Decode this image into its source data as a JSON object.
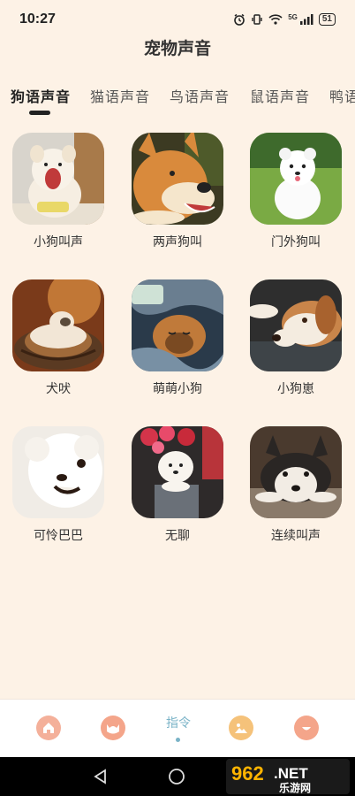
{
  "status_bar": {
    "time": "10:27",
    "battery": "51",
    "network": "5G"
  },
  "page_title": "宠物声音",
  "tabs": [
    {
      "label": "狗语声音",
      "active": true
    },
    {
      "label": "猫语声音",
      "active": false
    },
    {
      "label": "鸟语声音",
      "active": false
    },
    {
      "label": "鼠语声音",
      "active": false
    },
    {
      "label": "鸭语",
      "active": false
    }
  ],
  "sounds": [
    {
      "label": "小狗叫声",
      "image": "fluffy-puppy-yawning"
    },
    {
      "label": "两声狗叫",
      "image": "shiba-barking"
    },
    {
      "label": "门外狗叫",
      "image": "white-pomeranian-on-grass"
    },
    {
      "label": "犬吠",
      "image": "puppy-sleeping-in-basket"
    },
    {
      "label": "萌萌小狗",
      "image": "brown-puppy-under-blanket"
    },
    {
      "label": "小狗崽",
      "image": "beagle-lying-on-sofa"
    },
    {
      "label": "可怜巴巴",
      "image": "smiling-white-pomeranian"
    },
    {
      "label": "无聊",
      "image": "maltese-with-flowers"
    },
    {
      "label": "连续叫声",
      "image": "husky-lying-down"
    }
  ],
  "bottom_nav": {
    "items": [
      {
        "name": "home",
        "icon": "home-icon",
        "color": "#f4a58a"
      },
      {
        "name": "cat",
        "icon": "cat-face-icon",
        "color": "#f4a58a"
      },
      {
        "name": "command",
        "label": "指令",
        "active": true,
        "color": "#7ab3c7"
      },
      {
        "name": "image",
        "icon": "image-icon",
        "color": "#f5c27a"
      },
      {
        "name": "face",
        "icon": "smile-face-icon",
        "color": "#f4a58a"
      }
    ]
  },
  "watermark": {
    "number": "962",
    "tld": ".NET",
    "site": "乐游网"
  },
  "colors": {
    "background": "#fdf2e6",
    "accent": "#7ab3c7",
    "nav_icon": "#f4a58a"
  }
}
